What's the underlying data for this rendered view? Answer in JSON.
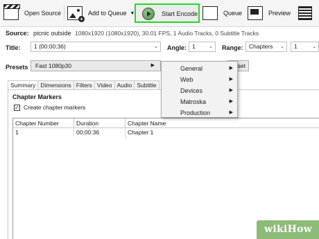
{
  "toolbar": {
    "open_source": "Open Source",
    "add_to_queue": "Add to Queue",
    "start_encode": "Start Encode",
    "queue": "Queue",
    "preview": "Preview"
  },
  "source": {
    "label": "Source:",
    "name": "picnic outside",
    "info": "1080x1920 (1080x1920), 30.01 FPS, 1 Audio Tracks, 0 Subtitle Tracks"
  },
  "title_row": {
    "title_label": "Title:",
    "title_value": "1 (00:00:36)",
    "angle_label": "Angle:",
    "angle_value": "1",
    "range_label": "Range:",
    "range_value": "Chapters",
    "range_start": "1"
  },
  "presets": {
    "label": "Presets",
    "value": "Fast 1080p30",
    "reset_button_fragment": "set"
  },
  "tabs": [
    "Summary",
    "Dimensions",
    "Filters",
    "Video",
    "Audio",
    "Subtitle"
  ],
  "chapters": {
    "heading": "Chapter Markers",
    "checkbox_label": "Create chapter markers",
    "checked": true,
    "columns": [
      "Chapter Number",
      "Duration",
      "Chapter Name"
    ],
    "rows": [
      {
        "number": "1",
        "duration": "00:00:36",
        "name": "Chapter 1"
      }
    ]
  },
  "preset_menu": {
    "items": [
      "General",
      "Web",
      "Devices",
      "Matroska",
      "Production"
    ]
  },
  "watermark": {
    "wiki": "wiki",
    "how": "How"
  },
  "colors": {
    "highlight": "#22d822",
    "watermark_bg": "#8dbb78"
  }
}
